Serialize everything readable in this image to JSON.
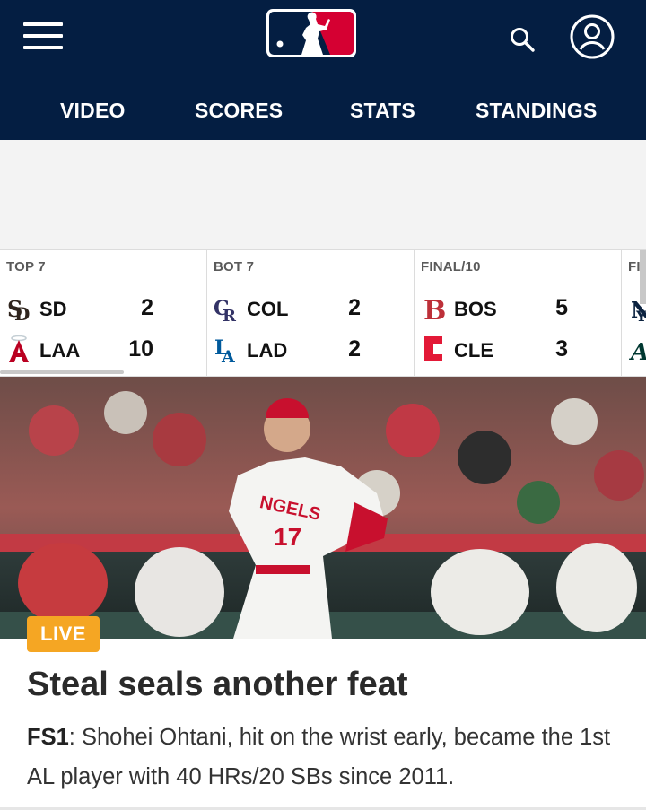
{
  "header": {
    "nav": [
      {
        "label": "VIDEO"
      },
      {
        "label": "SCORES"
      },
      {
        "label": "STATS"
      },
      {
        "label": "STANDINGS"
      }
    ],
    "logo_icon": "mlb-logo-icon",
    "search_icon": "search-icon",
    "account_icon": "user-icon",
    "menu_icon": "hamburger-menu-icon",
    "colors": {
      "nav_bg": "#041e42",
      "logo_red": "#d50032",
      "logo_blue": "#041e42"
    }
  },
  "scoreboard": {
    "games": [
      {
        "status": "TOP 7",
        "away": {
          "abbr": "SD",
          "score": "2",
          "logo": "padres-logo-icon",
          "color": "#2f241d"
        },
        "home": {
          "abbr": "LAA",
          "score": "10",
          "logo": "angels-logo-icon",
          "color": "#ba0021"
        }
      },
      {
        "status": "BOT 7",
        "away": {
          "abbr": "COL",
          "score": "2",
          "logo": "rockies-logo-icon",
          "color": "#333366"
        },
        "home": {
          "abbr": "LAD",
          "score": "2",
          "logo": "dodgers-logo-icon",
          "color": "#005a9c"
        }
      },
      {
        "status": "FINAL/10",
        "away": {
          "abbr": "BOS",
          "score": "5",
          "logo": "red-sox-logo-icon",
          "color": "#bd3039"
        },
        "home": {
          "abbr": "CLE",
          "score": "3",
          "logo": "guardians-logo-icon",
          "color": "#e31937"
        }
      },
      {
        "status": "FI",
        "away": {
          "abbr": "",
          "score": "",
          "logo": "yankees-logo-icon",
          "color": "#0c2340"
        },
        "home": {
          "abbr": "",
          "score": "",
          "logo": "athletics-logo-icon",
          "color": "#003831"
        }
      }
    ]
  },
  "hero": {
    "badge": "LIVE",
    "badge_color": "#f5a623",
    "image": "ohtani-running-photo"
  },
  "story": {
    "headline": "Steal seals another feat",
    "source": "FS1",
    "summary": ": Shohei Ohtani, hit on the wrist early, became the 1st AL player with 40 HRs/20 SBs since 2011."
  }
}
